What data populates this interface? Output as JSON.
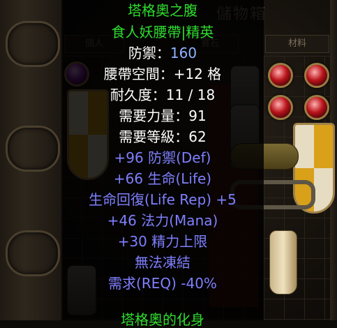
{
  "stash": {
    "title": "儲物箱",
    "tabs": [
      "個人",
      "寶石",
      "材料"
    ]
  },
  "tooltip": {
    "name": "塔格奧之腹",
    "type": "食人妖腰帶|精英",
    "defense_label": "防禦：",
    "defense_value": "160",
    "slots": "腰帶空間：+12 格",
    "durability": "耐久度：11 / 18",
    "req_str": "需要力量：91",
    "req_lvl": "需要等級：62",
    "mods": [
      "+96 防禦(Def)",
      "+66 生命(Life)",
      "生命回復(Life Rep) +5",
      "+46 法力(Mana)",
      "+30 精力上限",
      "無法凍結",
      "需求(REQ) -40%"
    ],
    "set_name": "塔格奧的化身"
  },
  "colors": {
    "unique_green": "#2fdc2f",
    "magic_blue": "#7f7fff",
    "text_white": "#ffffff"
  }
}
